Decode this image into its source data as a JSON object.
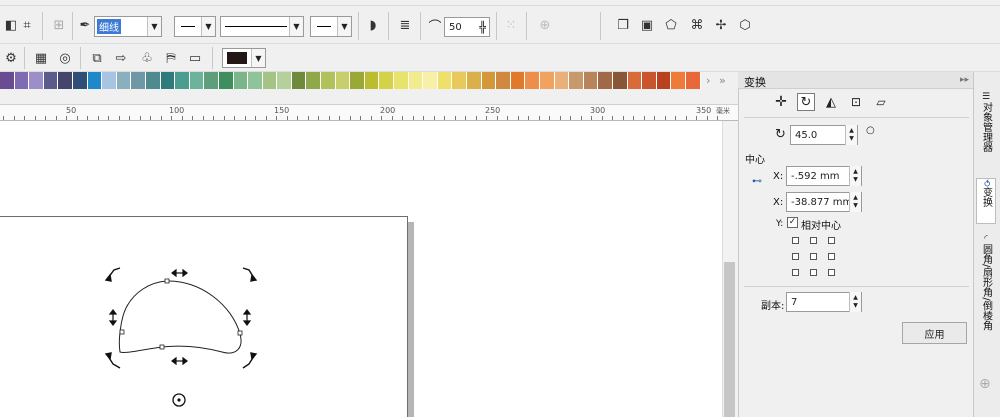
{
  "toolbar": {
    "outline_style_value": "细线",
    "outline_width_value": "",
    "smoothness_value": "50",
    "fill_color": "#231815"
  },
  "palette": {
    "colors": [
      "#6a4c93",
      "#7f6bb2",
      "#9c8fc7",
      "#5a5a8c",
      "#44446c",
      "#2f4f76",
      "#1e88c8",
      "#a7c4e2",
      "#8ab0bf",
      "#6f98a6",
      "#4e8a8f",
      "#2f7b7b",
      "#4a9d8f",
      "#6cb39b",
      "#5f9e7a",
      "#3e8e5e",
      "#7ab68a",
      "#8fc39a",
      "#a4c486",
      "#b5d09a",
      "#6e8b3d",
      "#8fa84a",
      "#b2c25a",
      "#c7cf6b",
      "#9aa836",
      "#b9bd2e",
      "#d5d24a",
      "#e8e36a",
      "#f3ec8e",
      "#f7f1a8",
      "#efe06a",
      "#e8c95c",
      "#d9b04a",
      "#d4983a",
      "#cf8a3f",
      "#e07a2a",
      "#ef8d4a",
      "#f0a25e",
      "#e9b07a",
      "#c79a6e",
      "#b8845a",
      "#a06a48",
      "#8a5638",
      "#d96b3a",
      "#c8552d",
      "#b8421f",
      "#f07a3a",
      "#e8683a"
    ]
  },
  "ruler": {
    "labels": [
      "50",
      "100",
      "150",
      "200",
      "250",
      "300",
      "350"
    ],
    "unit": "毫米"
  },
  "docker": {
    "title": "变换",
    "rotation_angle": "45.0",
    "center_heading": "中心",
    "x_label": "X:",
    "x_value": "-.592 mm",
    "y_label": "X:",
    "y_value": "-38.877 mm",
    "y_axis_marker": "Y:",
    "relative_center_label": "相对中心",
    "relative_center_checked": true,
    "copies_label": "副本:",
    "copies_value": "7",
    "apply_label": "应用"
  },
  "side_tabs": [
    {
      "label": "对象管理器",
      "active": false
    },
    {
      "label": "变换",
      "active": true
    },
    {
      "label": "圆角/扇形角/倒棱角",
      "active": false
    }
  ],
  "colors": {
    "accent_blue": "#1e88c8",
    "panel_bg": "#f0f0f0",
    "page_bg": "#ffffff"
  }
}
